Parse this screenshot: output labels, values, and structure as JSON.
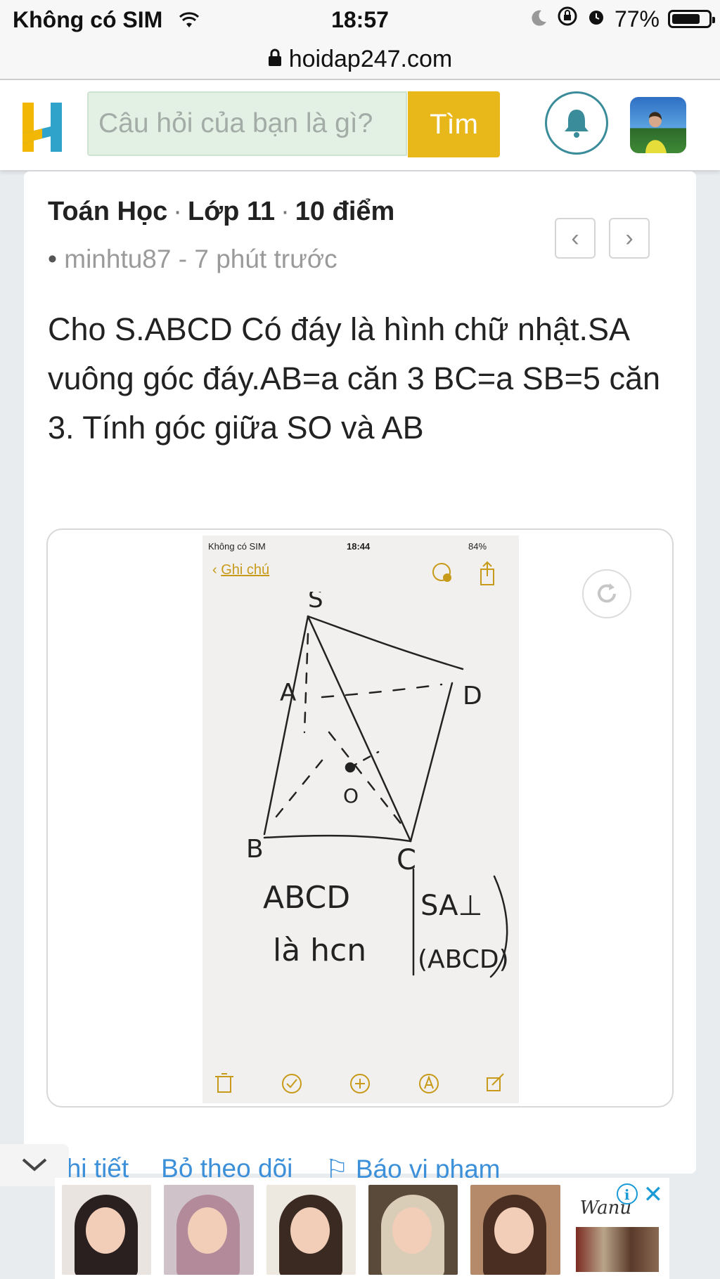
{
  "status_bar": {
    "carrier": "Không có SIM",
    "time": "18:57",
    "battery_percent": "77%",
    "battery_level": 0.77
  },
  "browser": {
    "url": "hoidap247.com"
  },
  "header": {
    "search_placeholder": "Câu hỏi của bạn là gì?",
    "search_button": "Tìm",
    "logo_letter": "H"
  },
  "question": {
    "subject": "Toán Học",
    "grade": "Lớp 11",
    "points": "10 điểm",
    "author_line": "minhtu87 - 7 phút trước",
    "body": "Cho S.ABCD Có đáy là hình chữ nhật.SA vuông góc đáy.AB=a căn 3 BC=a SB=5 căn 3. Tính góc giữa SO và AB",
    "nav_prev": "‹",
    "nav_next": "›"
  },
  "attachment": {
    "status_carrier": "Không có SIM",
    "status_time": "18:44",
    "status_battery": "84%",
    "back_label": "Ghi chú",
    "sketch_labels": {
      "s": "S",
      "a": "A",
      "d": "D",
      "o": "O",
      "b": "B",
      "c": "C",
      "note_line1": "ABCD",
      "note_line2": "là hcn",
      "note_line3": "SA⊥",
      "note_line4": "(ABCD)"
    }
  },
  "actions": {
    "detail": "Chi tiết",
    "unfollow": "Bỏ theo dõi",
    "report": "Báo vi phạm"
  },
  "ad": {
    "logo_text": "Wanu",
    "info_icon": "i",
    "close_icon": "✕"
  },
  "colors": {
    "accent_yellow": "#e8b71a",
    "link_blue": "#3c8fd9",
    "bell_teal": "#3a8c9a",
    "notes_gold": "#c79a1a"
  }
}
